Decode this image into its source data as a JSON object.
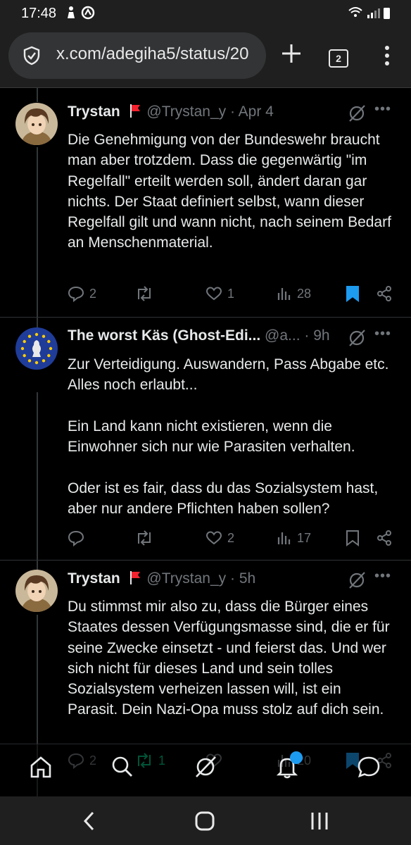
{
  "status_bar": {
    "time": "17:48"
  },
  "browser": {
    "url": "x.com/adegiha5/status/20",
    "tab_count": "2"
  },
  "tweets": [
    {
      "name": "Trystan",
      "handle": "@Trystan_y",
      "dot": "·",
      "date": "Apr 4",
      "text": "Die Genehmigung von der Bundeswehr braucht man aber trotzdem. Dass die gegenwärtig \"im Regelfall\" erteilt werden soll, ändert daran gar nichts. Der Staat definiert selbst, wann dieser Regelfall gilt und wann nicht,  nach seinem Bedarf an Menschenmaterial.",
      "replies": "2",
      "reposts": "",
      "likes": "1",
      "views": "28",
      "bookmarked": true
    },
    {
      "name": "The worst Käs (Ghost-Edi...",
      "handle": "@a...",
      "dot": "·",
      "date": "9h",
      "text": "Zur Verteidigung.  Auswandern,  Pass Abgabe etc. Alles noch erlaubt...\n\nEin Land kann nicht existieren,  wenn die Einwohner sich nur wie Parasiten verhalten.\n\nOder ist es fair,  dass du das Sozialsystem hast, aber nur andere Pflichten haben sollen?",
      "replies": "",
      "reposts": "",
      "likes": "2",
      "views": "17",
      "bookmarked": false
    },
    {
      "name": "Trystan",
      "handle": "@Trystan_y",
      "dot": "·",
      "date": "5h",
      "text": "Du stimmst mir also zu, dass die Bürger eines Staates dessen Verfügungsmasse sind, die er für seine Zwecke einsetzt - und feierst das. Und wer sich nicht für dieses Land und sein tolles Sozialsystem verheizen lassen will, ist ein Parasit. Dein Nazi-Opa muss stolz auf dich sein.",
      "replies": "2",
      "reposts": "1",
      "likes": "",
      "views": "20",
      "bookmarked": true
    }
  ],
  "colors": {
    "accent": "#1d9bf0",
    "repost_active": "#00ba7c",
    "muted": "#71767b",
    "flag": "#f4212e"
  },
  "icons": {
    "reply": "reply-icon",
    "repost": "repost-icon",
    "like": "heart-icon",
    "views": "views-icon",
    "bookmark": "bookmark-icon",
    "share": "share-icon",
    "grok": "grok-icon",
    "more": "more-icon"
  },
  "bottom_nav": [
    "home-icon",
    "search-icon",
    "grok-icon",
    "notifications-icon",
    "messages-icon"
  ]
}
